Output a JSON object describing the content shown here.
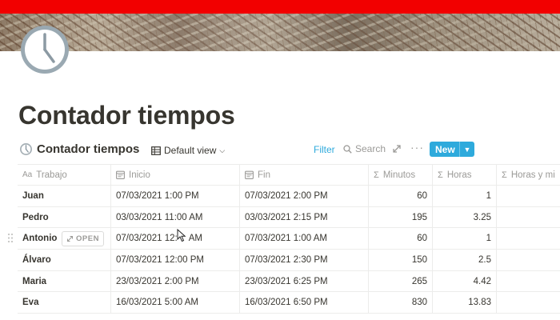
{
  "page": {
    "title": "Contador tiempos",
    "icon": "clock-icon"
  },
  "colors": {
    "top_bar": "#f20000",
    "accent": "#2eaadc",
    "text": "#37352f",
    "muted": "#9b9a97"
  },
  "database": {
    "title": "Contador tiempos",
    "view_label": "Default view",
    "filter_label": "Filter",
    "search_label": "Search",
    "new_label": "New",
    "open_label": "OPEN"
  },
  "table": {
    "columns": [
      {
        "icon": "Aa",
        "label": "Trabajo"
      },
      {
        "icon": "calendar-icon",
        "label": "Inicio"
      },
      {
        "icon": "calendar-icon",
        "label": "Fin"
      },
      {
        "icon": "Σ",
        "label": "Minutos"
      },
      {
        "icon": "Σ",
        "label": "Horas"
      },
      {
        "icon": "Σ",
        "label": "Horas y mi"
      }
    ],
    "rows": [
      {
        "trabajo": "Juan",
        "inicio": "07/03/2021 1:00 PM",
        "fin": "07/03/2021 2:00 PM",
        "minutos": "60",
        "horas": "1",
        "horas_min": ""
      },
      {
        "trabajo": "Pedro",
        "inicio": "03/03/2021 11:00 AM",
        "fin": "03/03/2021 2:15 PM",
        "minutos": "195",
        "horas": "3.25",
        "horas_min": ""
      },
      {
        "trabajo": "Antonio",
        "inicio": "07/03/2021 12:",
        "inicio_rest": "AM",
        "fin": "07/03/2021 1:00 AM",
        "minutos": "60",
        "horas": "1",
        "horas_min": ""
      },
      {
        "trabajo": "Álvaro",
        "inicio": "07/03/2021 12:00 PM",
        "fin": "07/03/2021 2:30 PM",
        "minutos": "150",
        "horas": "2.5",
        "horas_min": ""
      },
      {
        "trabajo": "Maria",
        "inicio": "23/03/2021 2:00 PM",
        "fin": "23/03/2021 6:25 PM",
        "minutos": "265",
        "horas": "4.42",
        "horas_min": ""
      },
      {
        "trabajo": "Eva",
        "inicio": "16/03/2021 5:00 AM",
        "fin": "16/03/2021 6:50 PM",
        "minutos": "830",
        "horas": "13.83",
        "horas_min": ""
      }
    ]
  }
}
